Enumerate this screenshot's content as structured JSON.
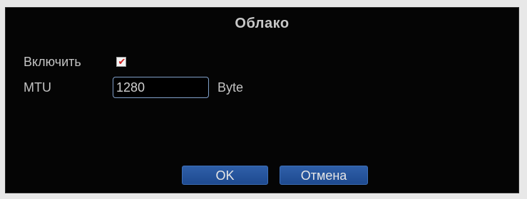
{
  "dialog": {
    "title": "Облако"
  },
  "enable": {
    "label": "Включить",
    "checked": true,
    "check_mark": "✔"
  },
  "mtu": {
    "label": "MTU",
    "value": "1280",
    "unit": "Byte"
  },
  "buttons": {
    "ok_label": "OK",
    "cancel_label": "Отмена"
  },
  "colors": {
    "background": "#050505",
    "text": "#c4c4c4",
    "button": "#2f5fa8",
    "input_border": "#7f9fc8",
    "check": "#d02020"
  }
}
